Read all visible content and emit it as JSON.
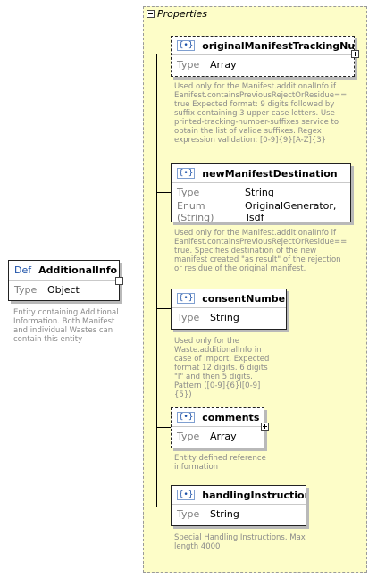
{
  "root": {
    "def_label": "Def",
    "name": "AdditionalInfo",
    "type_key": "Type",
    "type_value": "Object",
    "description": "Entity containing Additional Information. Both Manifest and individual Wastes can contain this entity"
  },
  "properties_title": "Properties",
  "properties": [
    {
      "icon": "{•}",
      "name": "originalManifestTrackingNu...",
      "type_key": "Type",
      "type_value": "Array",
      "description": "Used only for the Manifest.additionalInfo if Eanifest.containsPreviousRejectOrResidue== true  Expected format: 9 digits followed by suffix containing 3 upper case letters. Use printed-tracking-number-suffixes service to obtain the list of valide suffixes.  Regex expression validation: [0-9]{9}[A-Z]{3}"
    },
    {
      "icon": "{•}",
      "name": "newManifestDestination",
      "type_key": "Type",
      "type_value": "String",
      "enum_key": "Enum (String)",
      "enum_value": "OriginalGenerator, Tsdf",
      "description": "Used only for the Manifest.additionalInfo if Eanifest.containsPreviousRejectOrResidue== true. Specifies destination of the new manifest created \"as result\" of the rejection or residue of the original manifest."
    },
    {
      "icon": "{•}",
      "name": "consentNumber",
      "type_key": "Type",
      "type_value": "String",
      "description": "Used only for the Waste.additionalInfo in case of Import. Expected format 12 digits.  6 digits \"I\" and then 5 digits. Pattern ([0-9]{6}I[0-9]{5})"
    },
    {
      "icon": "{•}",
      "name": "comments",
      "type_key": "Type",
      "type_value": "Array",
      "description": "Entity defined reference information"
    },
    {
      "icon": "{•}",
      "name": "handlingInstructions",
      "type_key": "Type",
      "type_value": "String",
      "description": "Special Handling Instructions. Max length 4000"
    }
  ]
}
